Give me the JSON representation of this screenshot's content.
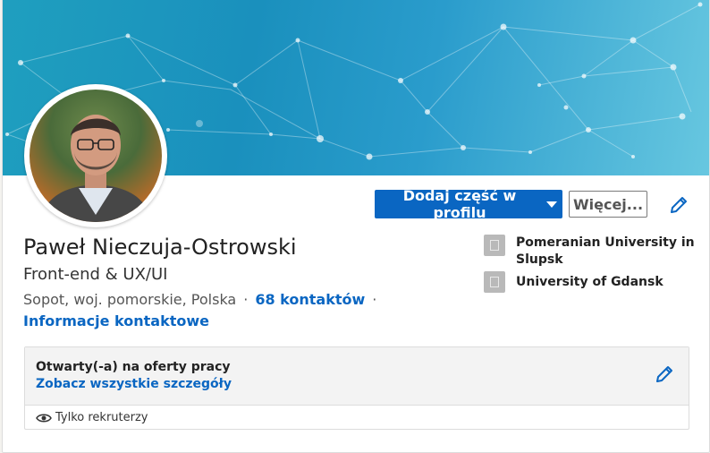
{
  "profile": {
    "name": "Paweł Nieczuja-Ostrowski",
    "headline": "Front-end & UX/UI",
    "location": "Sopot, woj. pomorskie, Polska",
    "connections": "68 kontaktów",
    "contact_info": "Informacje kontaktowe"
  },
  "actions": {
    "add_section": "Dodaj część w profilu",
    "more": "Więcej..."
  },
  "education": [
    {
      "name": "Pomeranian University in Slupsk",
      "icon": "building-icon"
    },
    {
      "name": "University of Gdansk",
      "icon": "school-icon"
    }
  ],
  "open_to_work": {
    "title": "Otwarty(-a) na oferty pracy",
    "link": "Zobacz wszystkie szczegóły",
    "visibility": "Tylko rekruterzy"
  },
  "colors": {
    "primary": "#0a66c2",
    "banner": "#1a90bd"
  }
}
